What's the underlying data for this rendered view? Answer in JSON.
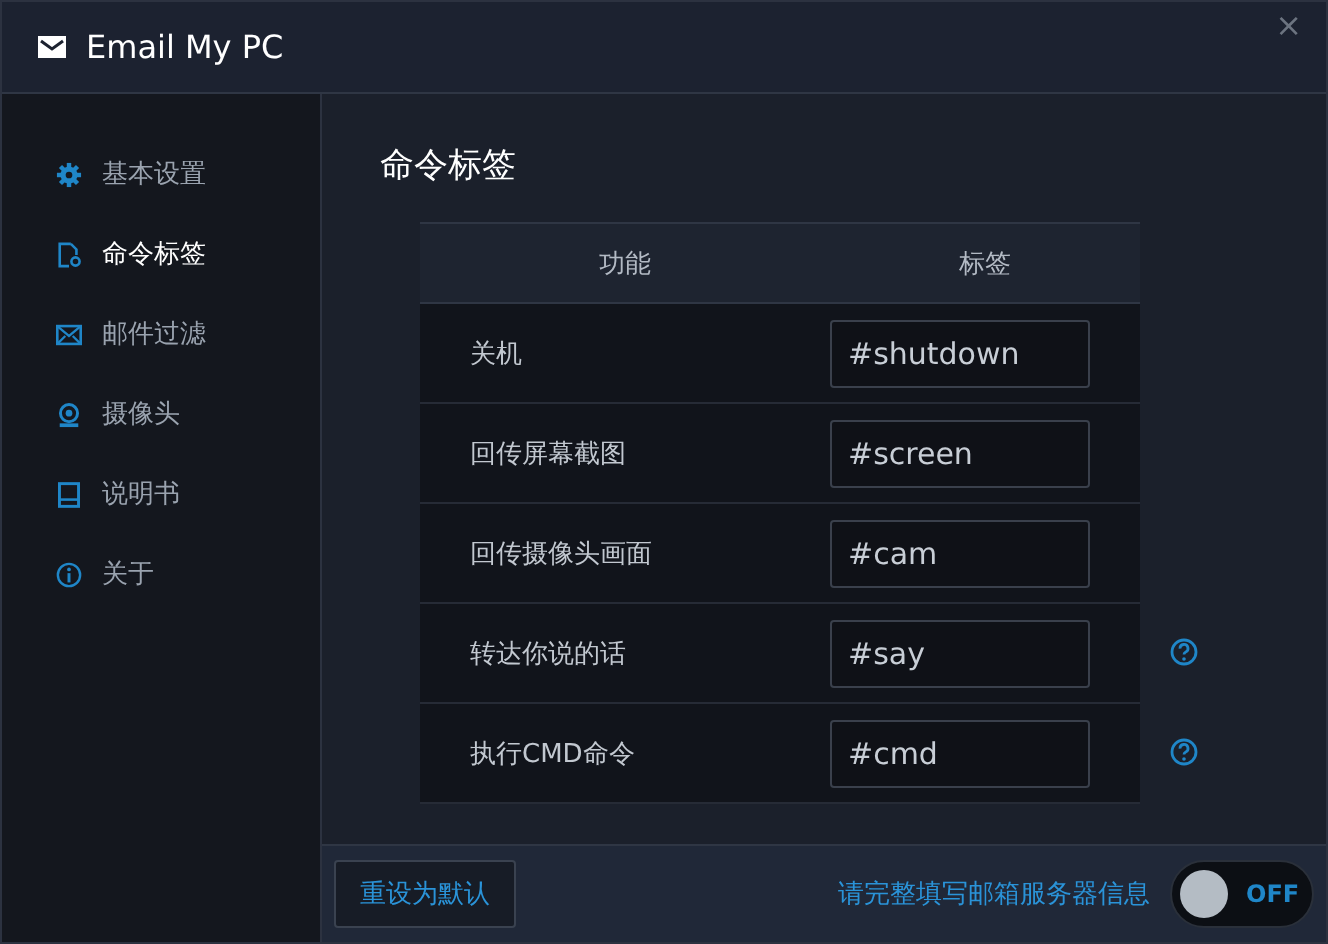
{
  "window": {
    "title": "Email My PC",
    "close": "×"
  },
  "sidebar": {
    "items": [
      {
        "label": "基本设置",
        "selected": false
      },
      {
        "label": "命令标签",
        "selected": true
      },
      {
        "label": "邮件过滤",
        "selected": false
      },
      {
        "label": "摄像头",
        "selected": false
      },
      {
        "label": "说明书",
        "selected": false
      },
      {
        "label": "关于",
        "selected": false
      }
    ]
  },
  "page_title": "命令标签",
  "table": {
    "columns": [
      "功能",
      "标签"
    ],
    "rows": [
      {
        "function": "关机",
        "tag": "#shutdown",
        "help": false
      },
      {
        "function": "回传屏幕截图",
        "tag": "#screen",
        "help": false
      },
      {
        "function": "回传摄像头画面",
        "tag": "#cam",
        "help": false
      },
      {
        "function": "转达你说的话",
        "tag": "#say",
        "help": true
      },
      {
        "function": "执行CMD命令",
        "tag": "#cmd",
        "help": true
      }
    ]
  },
  "footer": {
    "reset_button": "重设为默认",
    "status": "请完整填写邮箱服务器信息",
    "switch": {
      "on": false,
      "label": "OFF"
    }
  }
}
